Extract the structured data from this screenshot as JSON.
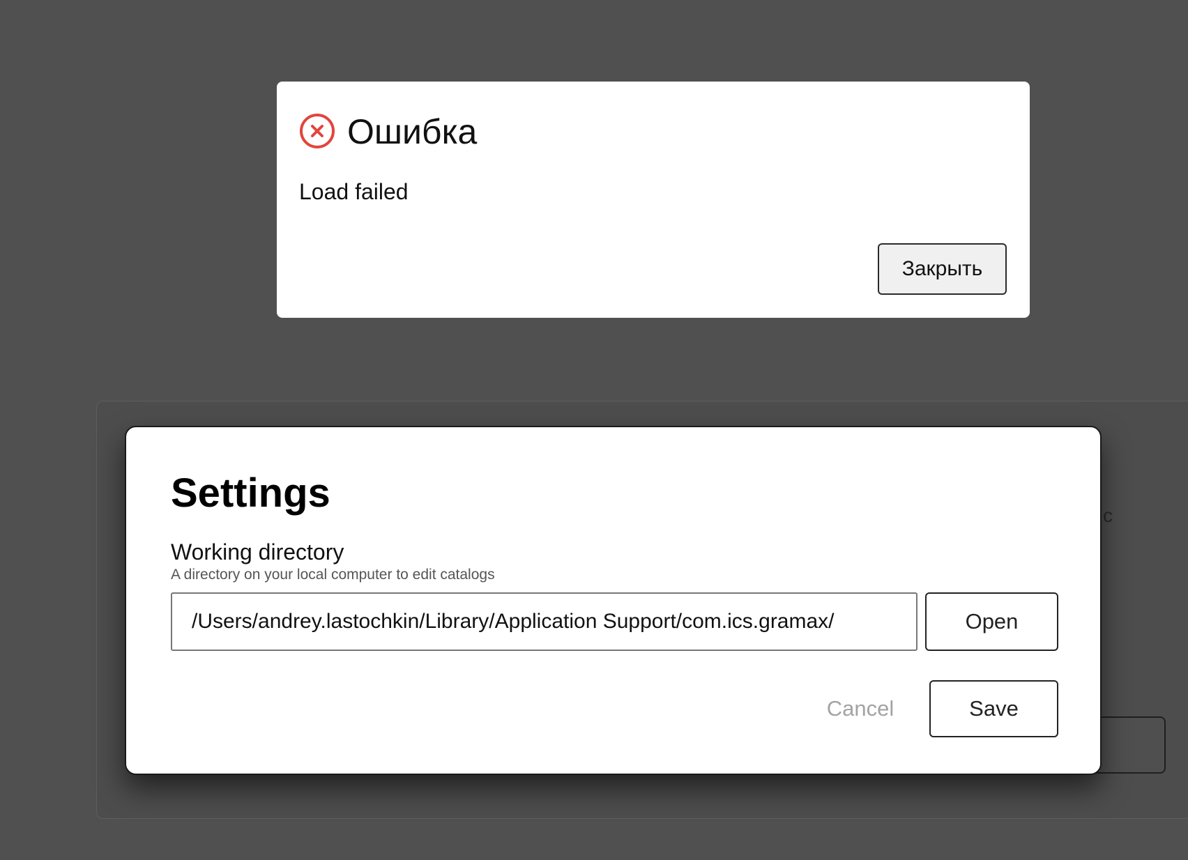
{
  "background": {
    "partial_label": "c"
  },
  "error_dialog": {
    "icon": "error-circle-x-icon",
    "icon_color": "#e2453c",
    "title": "Ошибка",
    "message": "Load failed",
    "close_label": "Закрыть"
  },
  "settings_dialog": {
    "title": "Settings",
    "working_directory": {
      "label": "Working directory",
      "hint": "A directory on your local computer to edit catalogs",
      "value": "/Users/andrey.lastochkin/Library/Application Support/com.ics.gramax/"
    },
    "open_label": "Open",
    "cancel_label": "Cancel",
    "save_label": "Save"
  }
}
